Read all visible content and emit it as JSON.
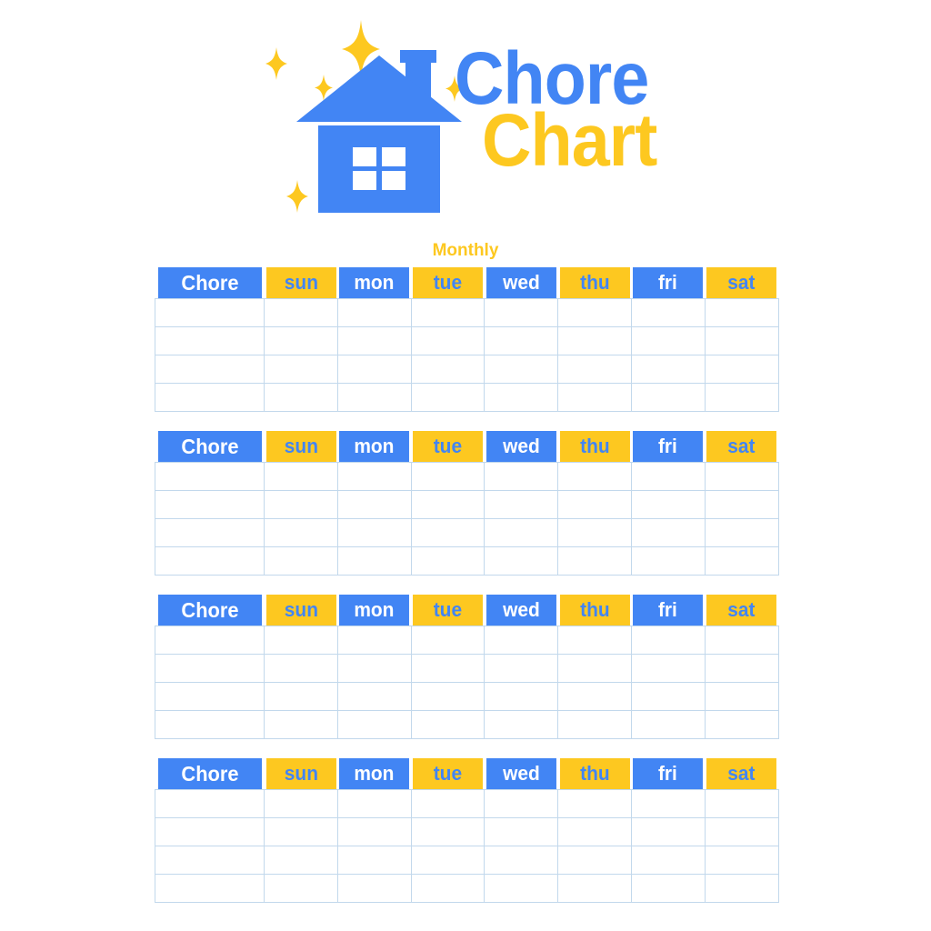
{
  "logo": {
    "icon_name": "house-with-sparkles-icon",
    "title_line1": "Chore",
    "title_line2": "Chart",
    "colors": {
      "blue": "#4285f4",
      "yellow": "#fdc820",
      "grid_line": "#c2d8ec",
      "background": "#ffffff"
    }
  },
  "section": {
    "label": "Monthly"
  },
  "table": {
    "headers": [
      {
        "label": "Chore",
        "style": "blue"
      },
      {
        "label": "sun",
        "style": "yellow"
      },
      {
        "label": "mon",
        "style": "blue"
      },
      {
        "label": "tue",
        "style": "yellow"
      },
      {
        "label": "wed",
        "style": "blue"
      },
      {
        "label": "thu",
        "style": "yellow"
      },
      {
        "label": "fri",
        "style": "blue"
      },
      {
        "label": "sat",
        "style": "yellow"
      }
    ],
    "body_row_count": 4,
    "column_count": 8,
    "rows": [
      [
        "",
        "",
        "",
        "",
        "",
        "",
        "",
        ""
      ],
      [
        "",
        "",
        "",
        "",
        "",
        "",
        "",
        ""
      ],
      [
        "",
        "",
        "",
        "",
        "",
        "",
        "",
        ""
      ],
      [
        "",
        "",
        "",
        "",
        "",
        "",
        "",
        ""
      ]
    ]
  },
  "tables": [
    {
      "index": 1
    },
    {
      "index": 2
    },
    {
      "index": 3
    },
    {
      "index": 4
    }
  ]
}
